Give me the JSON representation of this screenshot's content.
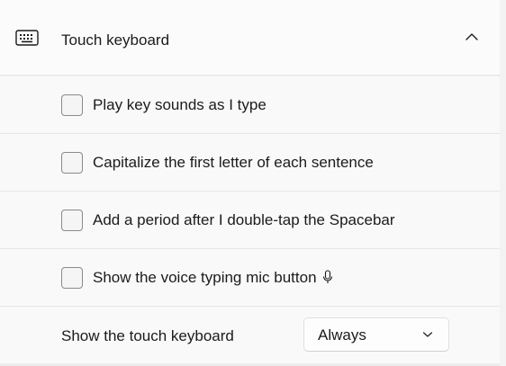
{
  "section": {
    "title": "Touch keyboard",
    "icon": "keyboard-icon",
    "expand_icon": "chevron-up-icon"
  },
  "options": [
    {
      "label": "Play key sounds as I type",
      "checked": false
    },
    {
      "label": "Capitalize the first letter of each sentence",
      "checked": false
    },
    {
      "label": "Add a period after I double-tap the Spacebar",
      "checked": false
    },
    {
      "label": "Show the voice typing mic button",
      "checked": false,
      "icon": "microphone-icon"
    }
  ],
  "show_keyboard": {
    "label": "Show the touch keyboard",
    "selected": "Always",
    "icon": "chevron-down-icon"
  }
}
